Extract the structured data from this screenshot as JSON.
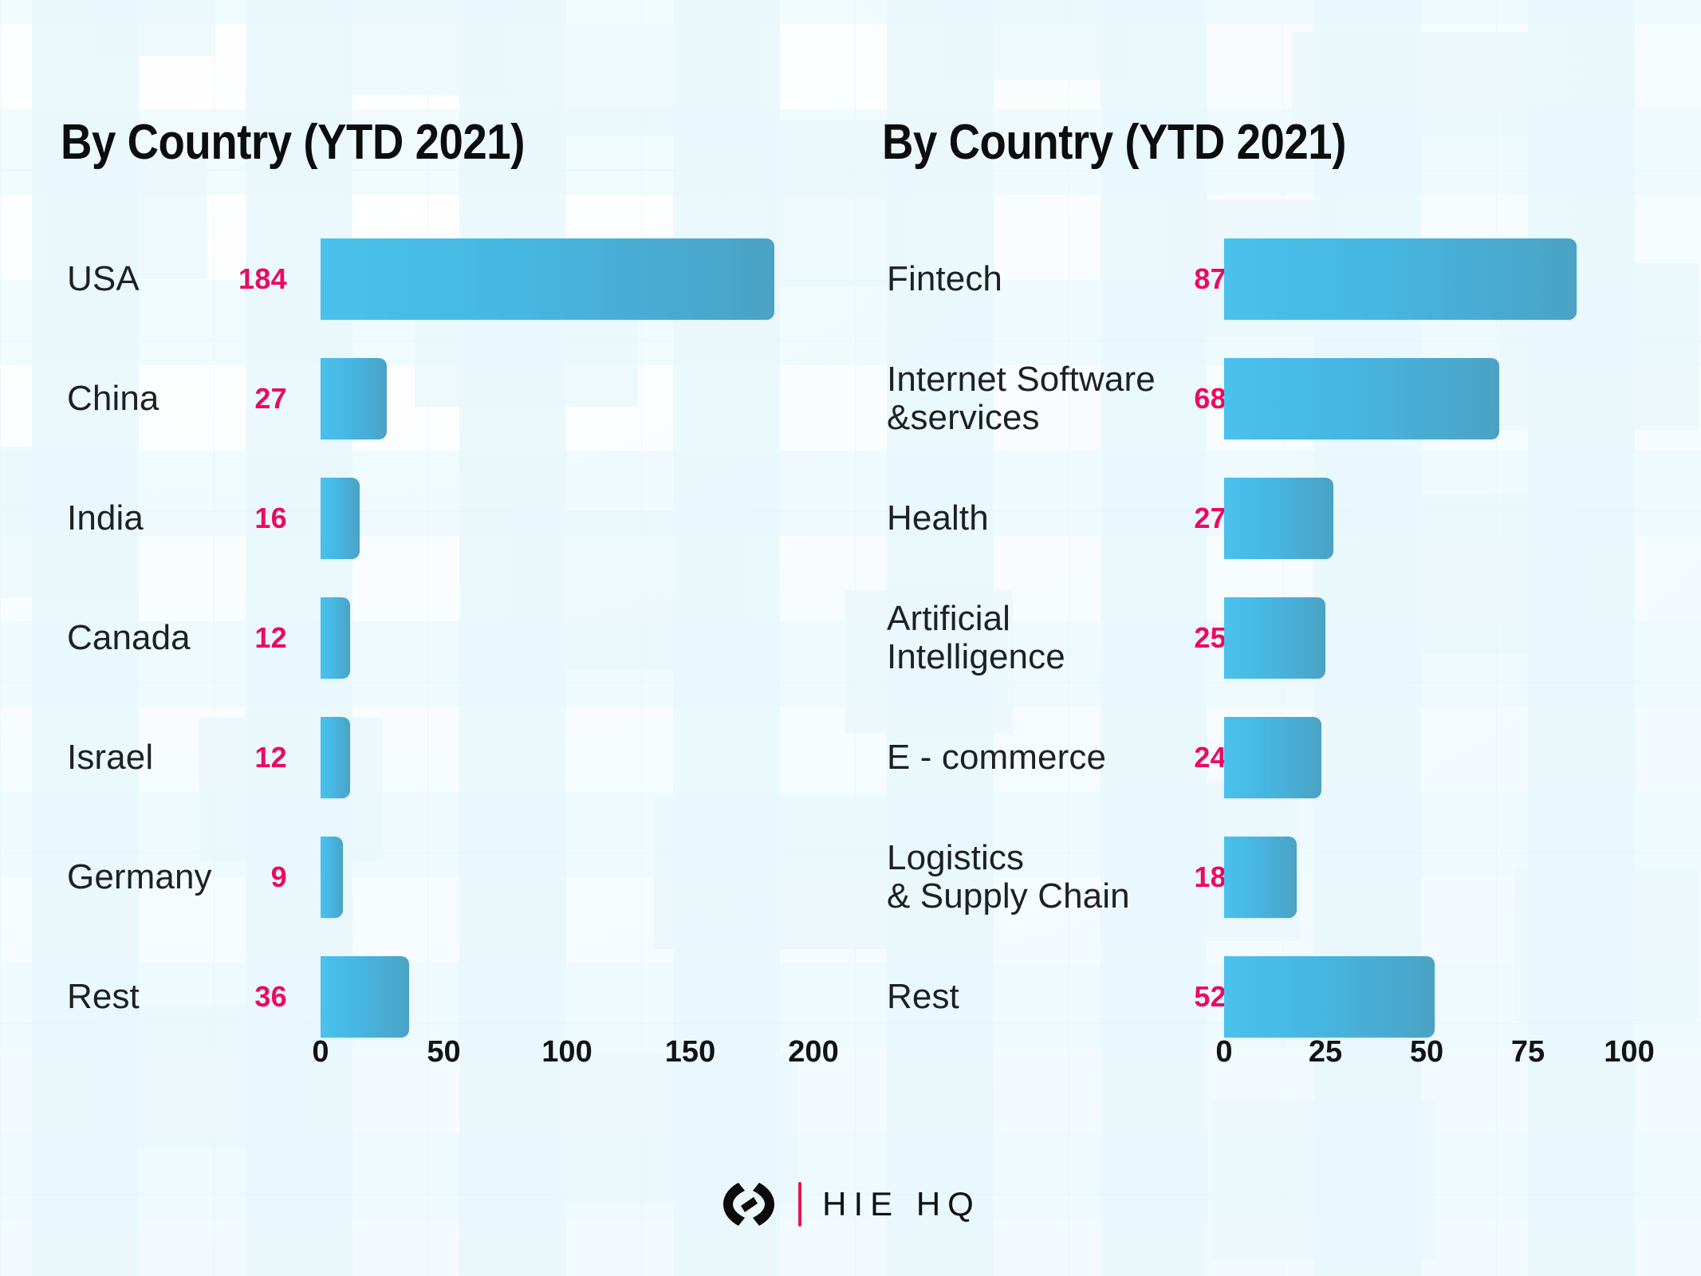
{
  "colors": {
    "bar_start": "#4ac1ec",
    "bar_end": "#4ba2c4",
    "value_label": "#eb0a63",
    "category_label": "#1f2022",
    "title": "#0d0d0d",
    "background": "#fbfdfe",
    "logo_accent": "#e8174f"
  },
  "footer": {
    "logo_mark_icon": "arc-bracket-diamond-logo-icon",
    "divider": "|",
    "wordmark": "HIE HQ"
  },
  "panels": [
    {
      "id": "by-country",
      "title": "By Country (YTD 2021)"
    },
    {
      "id": "by-sector",
      "title": "By Country (YTD 2021)"
    }
  ],
  "chart_data": [
    {
      "type": "bar",
      "orientation": "horizontal",
      "title": "By Country (YTD 2021)",
      "xlabel": "",
      "ylabel": "",
      "xlim": [
        0,
        200
      ],
      "xticks": [
        0,
        50,
        100,
        150,
        200
      ],
      "tick_labels": [
        "0",
        "50",
        "100",
        "150",
        "200"
      ],
      "grid": false,
      "legend": "none",
      "categories": [
        "USA",
        "China",
        "India",
        "Canada",
        "Israel",
        "Germany",
        "Rest"
      ],
      "values": [
        184,
        27,
        16,
        12,
        12,
        9,
        36
      ],
      "value_labels": [
        "184",
        "27",
        "16",
        "12",
        "12",
        "9",
        "36"
      ]
    },
    {
      "type": "bar",
      "orientation": "horizontal",
      "title": "By Country (YTD 2021)",
      "xlabel": "",
      "ylabel": "",
      "xlim": [
        0,
        100
      ],
      "xticks": [
        0,
        25,
        50,
        75,
        100
      ],
      "tick_labels": [
        "0",
        "25",
        "50",
        "75",
        "100"
      ],
      "grid": false,
      "legend": "none",
      "categories": [
        "Fintech",
        "Internet Software\n&services",
        "Health",
        "Artificial\nIntelligence",
        "E - commerce",
        "Logistics\n& Supply Chain",
        "Rest"
      ],
      "values": [
        87,
        68,
        27,
        25,
        24,
        18,
        52
      ],
      "value_labels": [
        "87",
        "68",
        "27",
        "25",
        "24",
        "18",
        "52"
      ]
    }
  ]
}
